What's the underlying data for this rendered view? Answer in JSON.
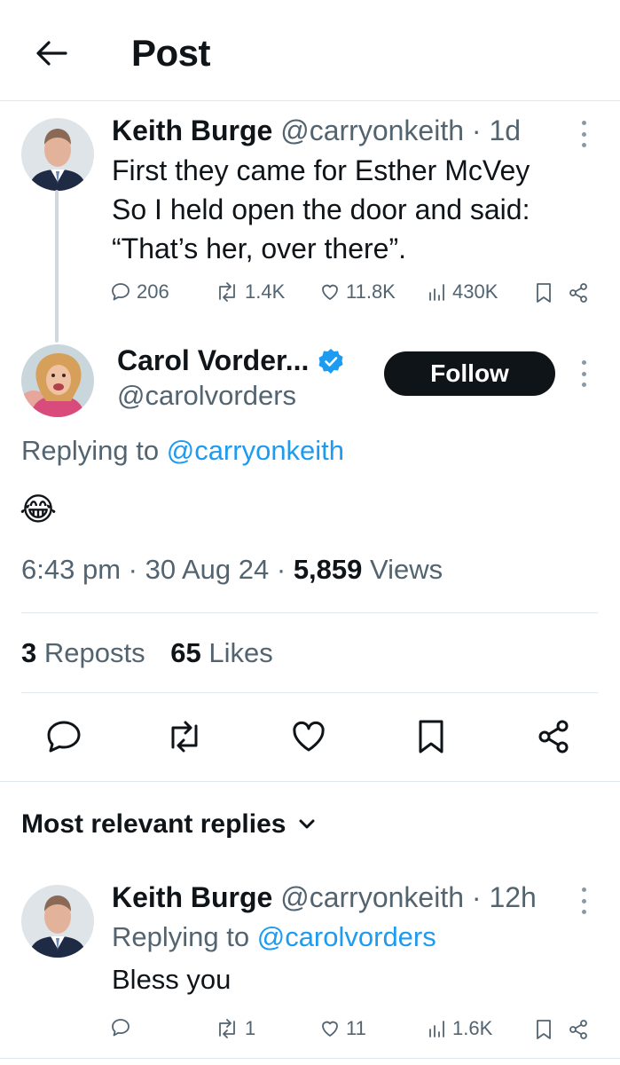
{
  "header": {
    "title": "Post"
  },
  "parent_tweet": {
    "name": "Keith Burge",
    "handle": "@carryonkeith",
    "time": "· 1d",
    "lines": [
      "First they came for Esther McVey",
      "So I held open the door and said:",
      "“That’s her, over there”."
    ],
    "replies": "206",
    "reposts": "1.4K",
    "likes": "11.8K",
    "views": "430K"
  },
  "main_tweet": {
    "name": "Carol Vorder...",
    "handle": "@carolvorders",
    "follow_label": "Follow",
    "replying_prefix": "Replying to",
    "replying_to": "@carryonkeith",
    "emoji": "😂",
    "time": "6:43 pm",
    "date": "30 Aug 24",
    "views_count": "5,859",
    "views_label": "Views",
    "sep": "·",
    "reposts_count": "3",
    "reposts_label": "Reposts",
    "likes_count": "65",
    "likes_label": "Likes"
  },
  "replies_section": {
    "title": "Most relevant replies"
  },
  "reply_tweet": {
    "name": "Keith Burge",
    "handle": "@carryonkeith",
    "time": "· 12h",
    "replying_prefix": "Replying to",
    "replying_to": "@carolvorders",
    "text": "Bless you",
    "replies": "",
    "reposts": "1",
    "likes": "11",
    "views": "1.6K"
  },
  "colors": {
    "accent": "#1d9bf0",
    "text": "#0f1419",
    "muted": "#536471",
    "border": "#e1e8ed"
  },
  "icons": [
    "back-arrow-icon",
    "more-dots-icon",
    "reply-icon",
    "repost-icon",
    "like-icon",
    "views-icon",
    "bookmark-icon",
    "share-icon",
    "verified-badge-icon",
    "chevron-down-icon"
  ]
}
